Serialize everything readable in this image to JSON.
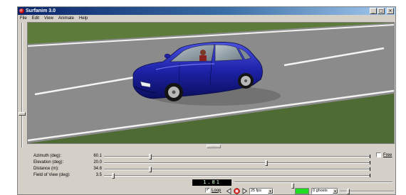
{
  "window": {
    "title": "Surfanim 3.0",
    "controls": {
      "minimize": "_",
      "maximize": "□",
      "close": "×"
    }
  },
  "menu": [
    "File",
    "Edit",
    "View",
    "Animate",
    "Help"
  ],
  "camera": {
    "azimuth": {
      "label": "Azimuth (deg):",
      "value": "60.1",
      "position": 0.17
    },
    "elevation": {
      "label": "Elevation (deg):",
      "value": "20.0",
      "position": 0.61
    },
    "distance": {
      "label": "Distance (m):",
      "value": "34.8",
      "position": 0.17
    },
    "fov": {
      "label": "Field of View (deg):",
      "value": "3.5",
      "position": 0.03
    },
    "free": {
      "label": "Free",
      "checked": false
    }
  },
  "playback": {
    "timecode": "1.81",
    "loop": {
      "label": "Loop",
      "checked": true
    },
    "fps": "25 fps",
    "ghost_color": "#22dd22",
    "ghosts": "0 ghosts",
    "icons": [
      "rewind-icon",
      "stop-icon",
      "play-icon"
    ]
  },
  "colors": {
    "titlebar": "#0a246a",
    "car": "#1d22a8",
    "road": "#8b8b8b",
    "grass": "#4e6b33"
  }
}
